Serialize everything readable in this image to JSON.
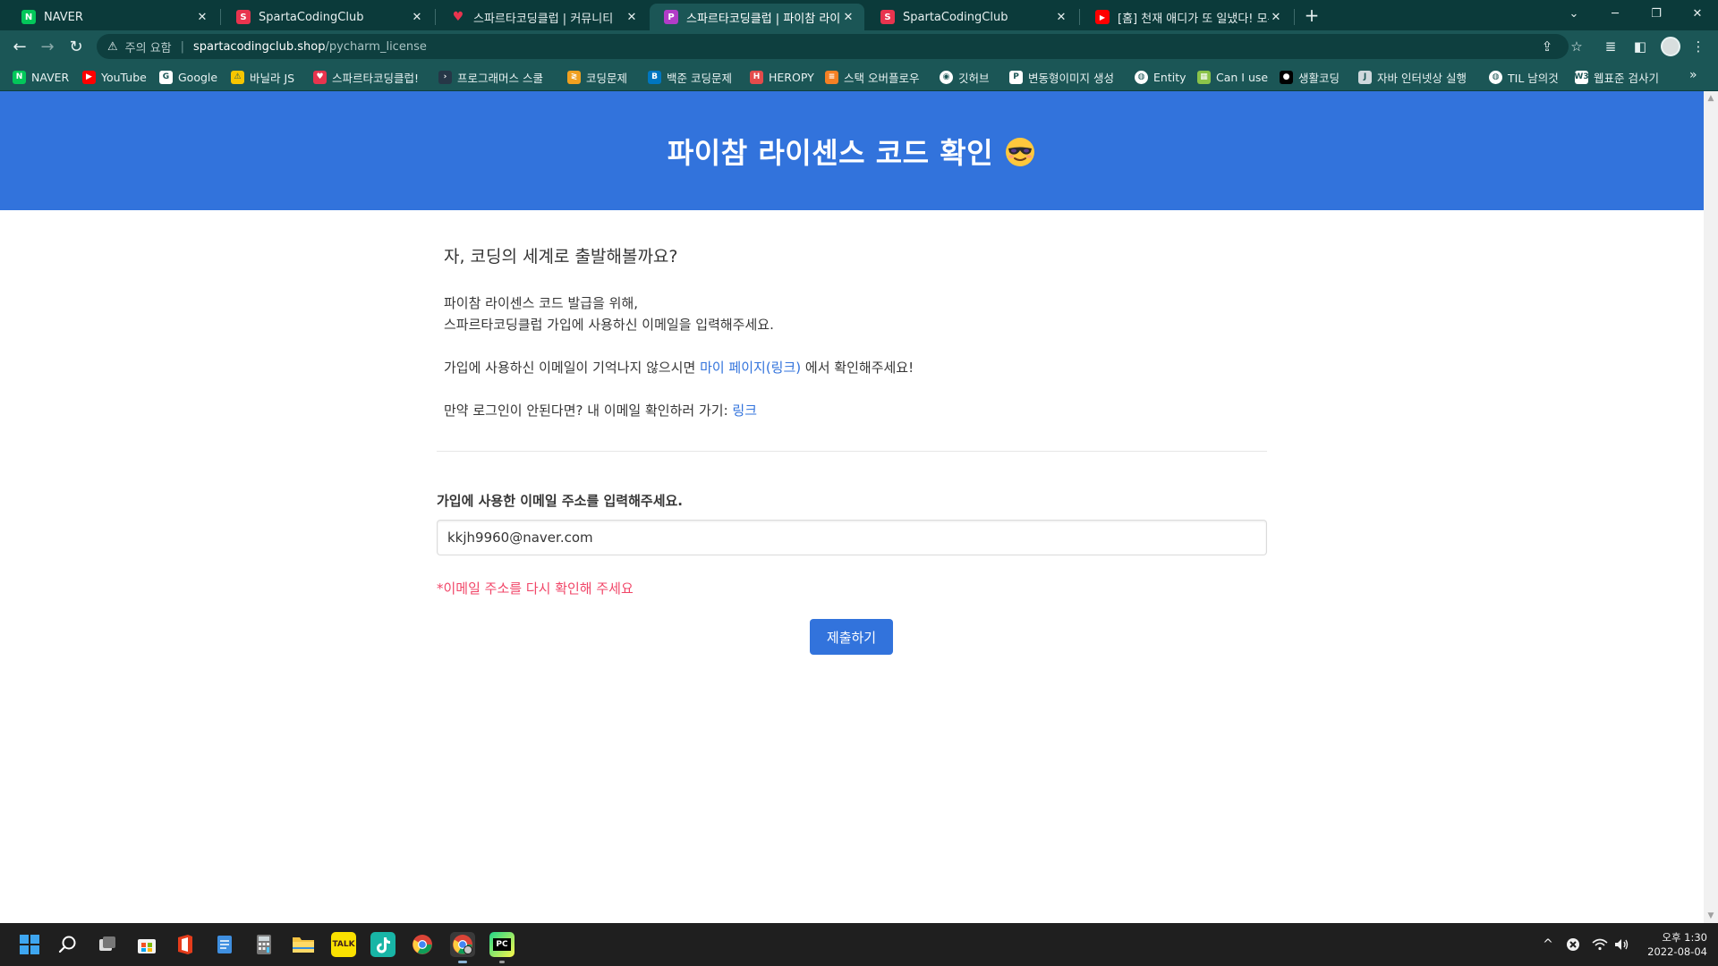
{
  "tabs": [
    {
      "title": "NAVER",
      "favicon": "naver-icon",
      "color": "#03c75a",
      "glyph": "N"
    },
    {
      "title": "SpartaCodingClub",
      "favicon": "sparta-icon",
      "color": "#e8344e",
      "glyph": "S"
    },
    {
      "title": "스파르타코딩클럽 | 커뮤니티",
      "favicon": "sparta-heart-icon",
      "color": "#e8344e",
      "glyph": "♥"
    },
    {
      "title": "스파르타코딩클럽 | 파이참 라이",
      "favicon": "sparta-pycharm-icon",
      "color": "#b23cc8",
      "glyph": "P"
    },
    {
      "title": "SpartaCodingClub",
      "favicon": "sparta-icon",
      "color": "#e8344e",
      "glyph": "S"
    },
    {
      "title": "[홈] 천재 애디가 또 일냈다! 모두",
      "favicon": "youtube-icon",
      "color": "#ff0000",
      "glyph": "▶"
    }
  ],
  "omnibox": {
    "security": "주의 요함",
    "host": "spartacodingclub.shop",
    "path": "/pycharm_license"
  },
  "bookmarks": [
    {
      "label": "NAVER",
      "icon": "naver-icon",
      "color": "#03c75a",
      "glyph": "N"
    },
    {
      "label": "YouTube",
      "icon": "youtube-icon",
      "color": "#ff0000",
      "glyph": "▶"
    },
    {
      "label": "Google",
      "icon": "google-icon",
      "color": "#ffffff",
      "glyph": "G"
    },
    {
      "label": "바닐라 JS",
      "icon": "warning-icon",
      "color": "#f7c600",
      "glyph": "⚠"
    },
    {
      "label": "스파르타코딩클럽!",
      "icon": "sparta-heart-icon",
      "color": "#e8344e",
      "glyph": "♥"
    },
    {
      "label": "프로그래머스 스쿨",
      "icon": "programmers-icon",
      "color": "#263747",
      "glyph": "›"
    },
    {
      "label": "코딩문제",
      "icon": "coding-icon",
      "color": "#f0a020",
      "glyph": "≷"
    },
    {
      "label": "백준 코딩문제",
      "icon": "baekjoon-icon",
      "color": "#0076c0",
      "glyph": "B"
    },
    {
      "label": "HEROPY",
      "icon": "heropy-icon",
      "color": "#e44b4b",
      "glyph": "H"
    },
    {
      "label": "스택 오버플로우",
      "icon": "stackoverflow-icon",
      "color": "#f48024",
      "glyph": "≡"
    },
    {
      "label": "깃허브",
      "icon": "github-icon",
      "color": "#ffffff",
      "glyph": "◉"
    },
    {
      "label": "변동형이미지 생성",
      "icon": "p-icon",
      "color": "#ffffff",
      "glyph": "P"
    },
    {
      "label": "Entity",
      "icon": "globe-icon",
      "color": "#ffffff",
      "glyph": "◍"
    },
    {
      "label": "Can I use",
      "icon": "caniuse-icon",
      "color": "#8bc34a",
      "glyph": "▦"
    },
    {
      "label": "생활코딩",
      "icon": "opentutorials-icon",
      "color": "#000000",
      "glyph": "●"
    },
    {
      "label": "자바 인터넷상 실행",
      "icon": "java-icon",
      "color": "#cfd8dc",
      "glyph": "J"
    },
    {
      "label": "TIL 남의것",
      "icon": "globe-icon",
      "color": "#ffffff",
      "glyph": "◍"
    },
    {
      "label": "웹표준 검사기",
      "icon": "w3c-icon",
      "color": "#ffffff",
      "glyph": "W3"
    }
  ],
  "page": {
    "title": "파이참 라이센스 코드 확인",
    "lead": "자, 코딩의 세계로 출발해볼까요?",
    "para1_line1": "파이참 라이센스 코드 발급을 위해,",
    "para1_line2": "스파르타코딩클럽 가입에 사용하신 이메일을 입력해주세요.",
    "para2_text": "가입에 사용하신 이메일이 기억나지 않으시면",
    "para2_link": "마이 페이지(링크)",
    "para2_tail": "에서 확인해주세요!",
    "para3_text": "만약 로그인이 안된다면? 내 이메일 확인하러 가기:",
    "para3_link": "링크",
    "email_label": "가입에 사용한 이메일 주소를 입력해주세요.",
    "email_value": "kkjh9960@naver.com",
    "error": "*이메일 주소를 다시 확인해 주세요",
    "submit": "제출하기"
  },
  "taskbar": {
    "apps": [
      {
        "name": "start-icon"
      },
      {
        "name": "search-icon"
      },
      {
        "name": "task-view-icon"
      },
      {
        "name": "store-icon"
      },
      {
        "name": "office-icon"
      },
      {
        "name": "notepad-icon"
      },
      {
        "name": "calculator-icon"
      },
      {
        "name": "file-explorer-icon"
      },
      {
        "name": "kakaotalk-icon"
      },
      {
        "name": "tiktok-icon"
      },
      {
        "name": "chrome-icon"
      },
      {
        "name": "chrome-profile-icon"
      },
      {
        "name": "pycharm-icon"
      }
    ],
    "kakao_label": "TALK",
    "pycharm_label": "PC",
    "time": "오후 1:30",
    "date": "2022-08-04"
  },
  "colors": {
    "hero": "#3273dc",
    "link": "#3273dc",
    "error": "#f14668",
    "chrome_frame": "#0b3a3a",
    "chrome_toolbar": "#1b5656"
  }
}
